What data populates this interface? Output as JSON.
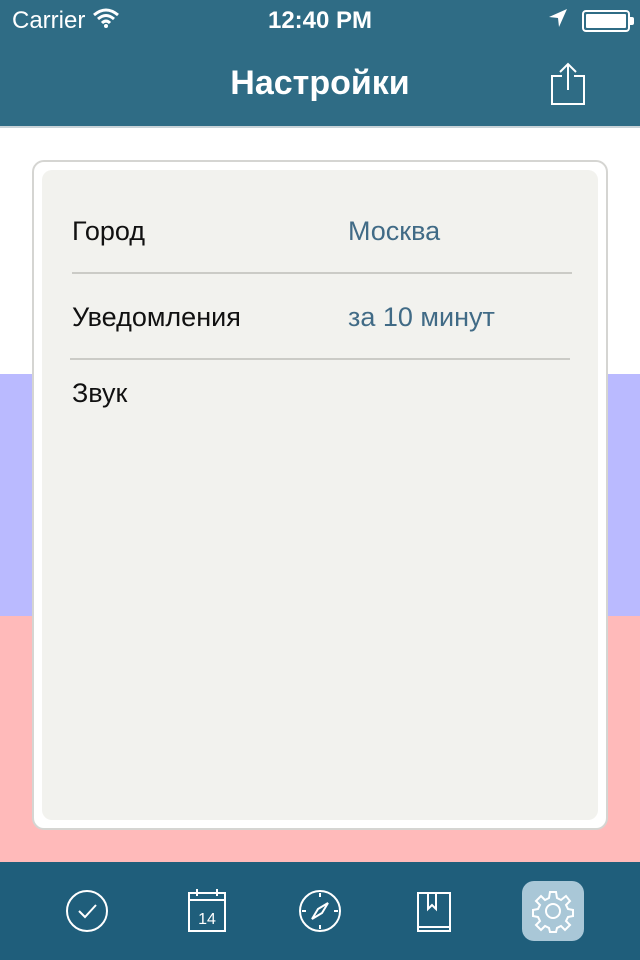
{
  "status_bar": {
    "carrier": "Carrier",
    "time": "12:40 PM",
    "icons": [
      "wifi-icon",
      "location-arrow-icon",
      "battery-icon"
    ]
  },
  "nav": {
    "title": "Настройки",
    "share_icon": "share-icon"
  },
  "settings": {
    "rows": [
      {
        "label": "Город",
        "value": "Москва"
      },
      {
        "label": "Уведомления",
        "value": "за 10 минут"
      },
      {
        "label": "Звук",
        "value": ""
      }
    ]
  },
  "background_flag": {
    "colors": [
      "#ffffff",
      "#babaff",
      "#ffbaba"
    ]
  },
  "tab_bar": {
    "calendar_day": "14",
    "tabs": [
      {
        "icon": "checkmark-circle-icon",
        "active": false
      },
      {
        "icon": "calendar-icon",
        "active": false
      },
      {
        "icon": "compass-icon",
        "active": false
      },
      {
        "icon": "book-icon",
        "active": false
      },
      {
        "icon": "gear-icon",
        "active": true
      }
    ]
  },
  "colors": {
    "bar": "#2f6c85",
    "tab_bar": "#1f5e7b",
    "value_text": "#416b86",
    "active_tab": "#a9c7d7"
  }
}
